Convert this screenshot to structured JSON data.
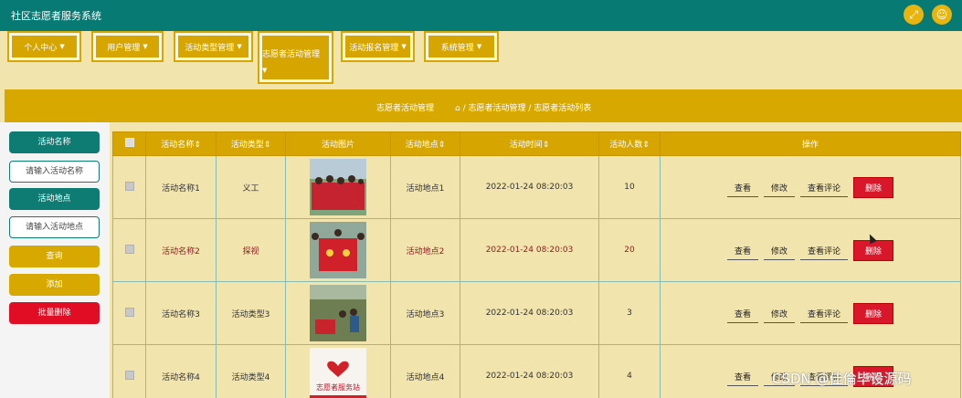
{
  "app": {
    "title": "社区志愿者服务系统"
  },
  "menu": [
    {
      "label": "个人中心"
    },
    {
      "label": "用户管理"
    },
    {
      "label": "活动类型管理"
    },
    {
      "label": "志愿者活动管理"
    },
    {
      "label": "活动报名管理"
    },
    {
      "label": "系统管理"
    }
  ],
  "breadcrumb": {
    "title": "志愿者活动管理",
    "path": "/ 志愿者活动管理 / 志愿者活动列表"
  },
  "search": {
    "name_label": "活动名称",
    "name_placeholder": "请输入活动名称",
    "place_label": "活动地点",
    "place_placeholder": "请输入活动地点",
    "query_btn": "查询",
    "add_btn": "添加",
    "batch_delete_btn": "批量删除"
  },
  "table": {
    "headers": [
      "活动名称",
      "活动类型",
      "活动图片",
      "活动地点",
      "活动时间",
      "活动人数",
      "操作"
    ],
    "rows": [
      {
        "name": "活动名称1",
        "type": "义工",
        "place": "活动地点1",
        "time": "2022-01-24 08:20:03",
        "count": "10"
      },
      {
        "name": "活动名称2",
        "type": "探视",
        "place": "活动地点2",
        "time": "2022-01-24 08:20:03",
        "count": "20"
      },
      {
        "name": "活动名称3",
        "type": "活动类型3",
        "place": "活动地点3",
        "time": "2022-01-24 08:20:03",
        "count": "3"
      },
      {
        "name": "活动名称4",
        "type": "活动类型4",
        "place": "活动地点4",
        "time": "2022-01-24 08:20:03",
        "count": "4"
      }
    ],
    "actions": {
      "view": "查看",
      "edit": "修改",
      "comments": "查看评论",
      "delete": "删除"
    },
    "photo_caption": "志愿者服务站"
  },
  "watermark": "CSDN @佳倫毕设源码"
}
